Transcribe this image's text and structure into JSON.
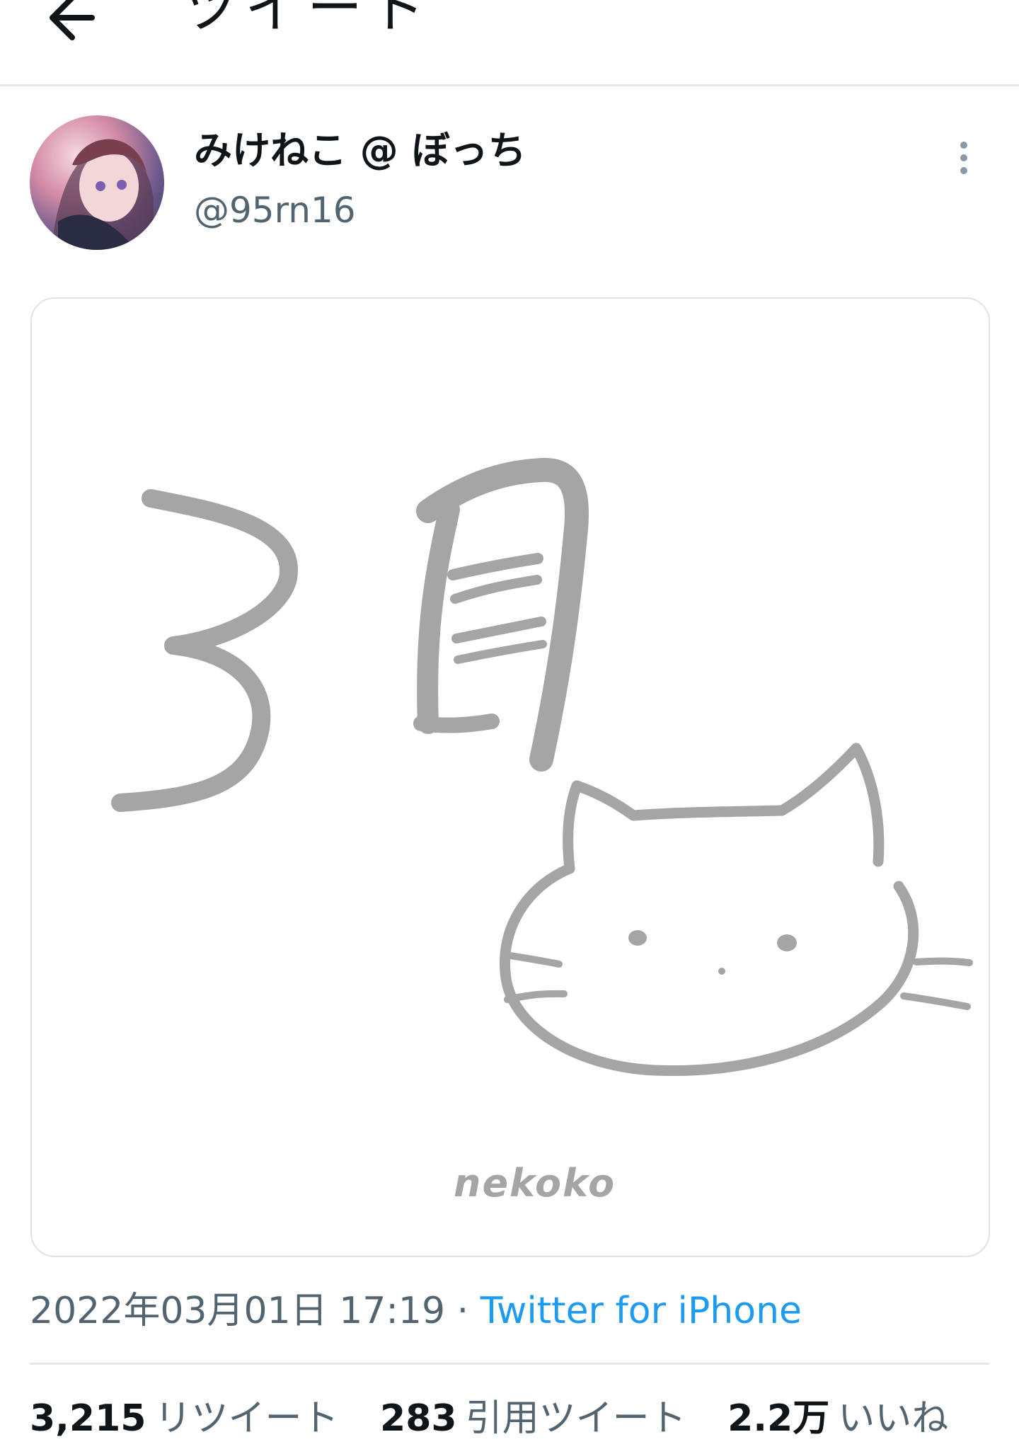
{
  "colors": {
    "text_primary": "#0f1419",
    "text_secondary": "#536471",
    "link": "#1d9bf0",
    "divider": "#e6e9ec",
    "drawing": "#a5a5a5"
  },
  "header": {
    "back_icon": "arrow-left-icon",
    "title": "ツイート"
  },
  "author": {
    "display_name": "みけねこ @ ぼっち",
    "handle": "@95rn16",
    "more_icon": "more-vertical-icon"
  },
  "media": {
    "watermark": "nekoko"
  },
  "meta": {
    "date": "2022年03月01日 17:19",
    "separator": "·",
    "source": "Twitter for iPhone"
  },
  "stats": {
    "retweets_count": "3,215",
    "retweets_label": "リツイート",
    "quotes_count": "283",
    "quotes_label": "引用ツイート",
    "likes_count": "2.2万",
    "likes_label": "いいね"
  }
}
